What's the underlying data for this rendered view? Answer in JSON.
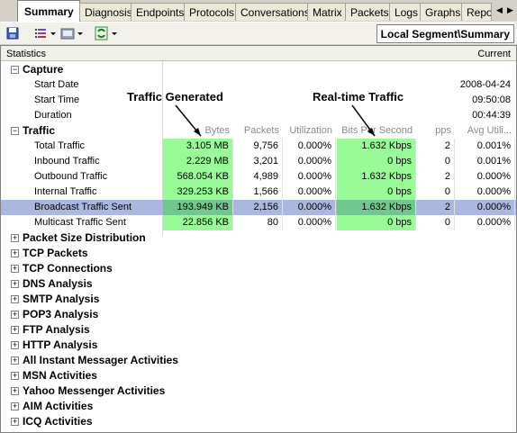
{
  "tabs": [
    {
      "label": "Summary",
      "active": true
    },
    {
      "label": "Diagnosis"
    },
    {
      "label": "Endpoints"
    },
    {
      "label": "Protocols"
    },
    {
      "label": "Conversations"
    },
    {
      "label": "Matrix"
    },
    {
      "label": "Packets"
    },
    {
      "label": "Logs"
    },
    {
      "label": "Graphs"
    },
    {
      "label": "Repor"
    }
  ],
  "toolbar": {
    "segment_label": "Local Segment\\Summary"
  },
  "grid": {
    "col_statistics": "Statistics",
    "col_current": "Current"
  },
  "capture": {
    "label": "Capture",
    "start_date_label": "Start Date",
    "start_date": "2008-04-24",
    "start_time_label": "Start Time",
    "start_time": "09:50:08",
    "duration_label": "Duration",
    "duration": "00:44:39"
  },
  "traffic": {
    "label": "Traffic",
    "headers": [
      "Bytes",
      "Packets",
      "Utilization",
      "Bits Per Second",
      "pps",
      "Avg Utili..."
    ],
    "rows": [
      {
        "name": "Total Traffic",
        "bytes": "3.105 MB",
        "packets": "9,756",
        "util": "0.000%",
        "bps": "1.632 Kbps",
        "pps": "2",
        "avg": "0.001%"
      },
      {
        "name": "Inbound Traffic",
        "bytes": "2.229 MB",
        "packets": "3,201",
        "util": "0.000%",
        "bps": "0 bps",
        "pps": "0",
        "avg": "0.001%"
      },
      {
        "name": "Outbound Traffic",
        "bytes": "568.054 KB",
        "packets": "4,989",
        "util": "0.000%",
        "bps": "1.632 Kbps",
        "pps": "2",
        "avg": "0.000%"
      },
      {
        "name": "Internal Traffic",
        "bytes": "329.253 KB",
        "packets": "1,566",
        "util": "0.000%",
        "bps": "0 bps",
        "pps": "0",
        "avg": "0.000%"
      },
      {
        "name": "Broadcast Traffic Sent",
        "bytes": "193.949 KB",
        "packets": "2,156",
        "util": "0.000%",
        "bps": "1.632 Kbps",
        "pps": "2",
        "avg": "0.000%"
      },
      {
        "name": "Multicast Traffic Sent",
        "bytes": "22.856 KB",
        "packets": "80",
        "util": "0.000%",
        "bps": "0 bps",
        "pps": "0",
        "avg": "0.000%"
      }
    ]
  },
  "sections": [
    "Packet Size Distribution",
    "TCP Packets",
    "TCP Connections",
    "DNS Analysis",
    "SMTP Analysis",
    "POP3 Analysis",
    "FTP Analysis",
    "HTTP Analysis",
    "All Instant Messager Activities",
    "MSN Activities",
    "Yahoo Messenger Activities",
    "AIM Activities",
    "ICQ Activities"
  ],
  "annotations": {
    "left": "Traffic Generated",
    "right": "Real-time Traffic"
  },
  "colors": {
    "highlight_green": "#98fb98",
    "selected_row": "#aab8e0"
  }
}
